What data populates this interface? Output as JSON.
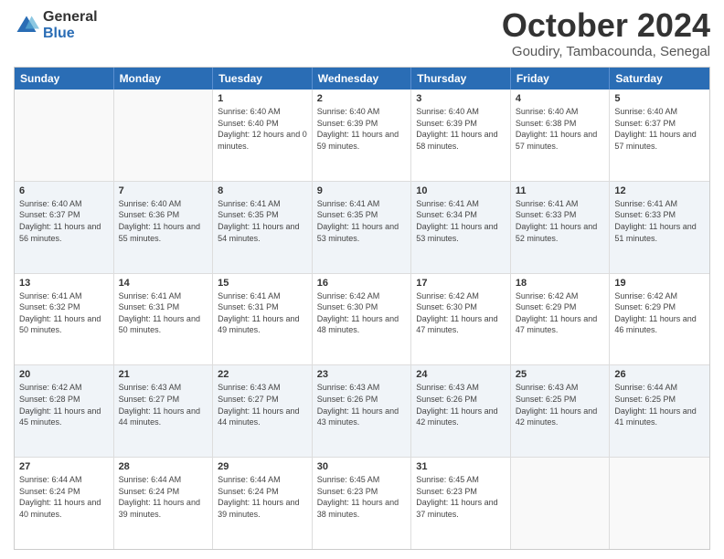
{
  "logo": {
    "general": "General",
    "blue": "Blue"
  },
  "title": "October 2024",
  "location": "Goudiry, Tambacounda, Senegal",
  "dayHeaders": [
    "Sunday",
    "Monday",
    "Tuesday",
    "Wednesday",
    "Thursday",
    "Friday",
    "Saturday"
  ],
  "weeks": [
    [
      {
        "day": "",
        "info": "",
        "empty": true
      },
      {
        "day": "",
        "info": "",
        "empty": true
      },
      {
        "day": "1",
        "info": "Sunrise: 6:40 AM\nSunset: 6:40 PM\nDaylight: 12 hours and 0 minutes.",
        "empty": false
      },
      {
        "day": "2",
        "info": "Sunrise: 6:40 AM\nSunset: 6:39 PM\nDaylight: 11 hours and 59 minutes.",
        "empty": false
      },
      {
        "day": "3",
        "info": "Sunrise: 6:40 AM\nSunset: 6:39 PM\nDaylight: 11 hours and 58 minutes.",
        "empty": false
      },
      {
        "day": "4",
        "info": "Sunrise: 6:40 AM\nSunset: 6:38 PM\nDaylight: 11 hours and 57 minutes.",
        "empty": false
      },
      {
        "day": "5",
        "info": "Sunrise: 6:40 AM\nSunset: 6:37 PM\nDaylight: 11 hours and 57 minutes.",
        "empty": false
      }
    ],
    [
      {
        "day": "6",
        "info": "Sunrise: 6:40 AM\nSunset: 6:37 PM\nDaylight: 11 hours and 56 minutes.",
        "empty": false
      },
      {
        "day": "7",
        "info": "Sunrise: 6:40 AM\nSunset: 6:36 PM\nDaylight: 11 hours and 55 minutes.",
        "empty": false
      },
      {
        "day": "8",
        "info": "Sunrise: 6:41 AM\nSunset: 6:35 PM\nDaylight: 11 hours and 54 minutes.",
        "empty": false
      },
      {
        "day": "9",
        "info": "Sunrise: 6:41 AM\nSunset: 6:35 PM\nDaylight: 11 hours and 53 minutes.",
        "empty": false
      },
      {
        "day": "10",
        "info": "Sunrise: 6:41 AM\nSunset: 6:34 PM\nDaylight: 11 hours and 53 minutes.",
        "empty": false
      },
      {
        "day": "11",
        "info": "Sunrise: 6:41 AM\nSunset: 6:33 PM\nDaylight: 11 hours and 52 minutes.",
        "empty": false
      },
      {
        "day": "12",
        "info": "Sunrise: 6:41 AM\nSunset: 6:33 PM\nDaylight: 11 hours and 51 minutes.",
        "empty": false
      }
    ],
    [
      {
        "day": "13",
        "info": "Sunrise: 6:41 AM\nSunset: 6:32 PM\nDaylight: 11 hours and 50 minutes.",
        "empty": false
      },
      {
        "day": "14",
        "info": "Sunrise: 6:41 AM\nSunset: 6:31 PM\nDaylight: 11 hours and 50 minutes.",
        "empty": false
      },
      {
        "day": "15",
        "info": "Sunrise: 6:41 AM\nSunset: 6:31 PM\nDaylight: 11 hours and 49 minutes.",
        "empty": false
      },
      {
        "day": "16",
        "info": "Sunrise: 6:42 AM\nSunset: 6:30 PM\nDaylight: 11 hours and 48 minutes.",
        "empty": false
      },
      {
        "day": "17",
        "info": "Sunrise: 6:42 AM\nSunset: 6:30 PM\nDaylight: 11 hours and 47 minutes.",
        "empty": false
      },
      {
        "day": "18",
        "info": "Sunrise: 6:42 AM\nSunset: 6:29 PM\nDaylight: 11 hours and 47 minutes.",
        "empty": false
      },
      {
        "day": "19",
        "info": "Sunrise: 6:42 AM\nSunset: 6:29 PM\nDaylight: 11 hours and 46 minutes.",
        "empty": false
      }
    ],
    [
      {
        "day": "20",
        "info": "Sunrise: 6:42 AM\nSunset: 6:28 PM\nDaylight: 11 hours and 45 minutes.",
        "empty": false
      },
      {
        "day": "21",
        "info": "Sunrise: 6:43 AM\nSunset: 6:27 PM\nDaylight: 11 hours and 44 minutes.",
        "empty": false
      },
      {
        "day": "22",
        "info": "Sunrise: 6:43 AM\nSunset: 6:27 PM\nDaylight: 11 hours and 44 minutes.",
        "empty": false
      },
      {
        "day": "23",
        "info": "Sunrise: 6:43 AM\nSunset: 6:26 PM\nDaylight: 11 hours and 43 minutes.",
        "empty": false
      },
      {
        "day": "24",
        "info": "Sunrise: 6:43 AM\nSunset: 6:26 PM\nDaylight: 11 hours and 42 minutes.",
        "empty": false
      },
      {
        "day": "25",
        "info": "Sunrise: 6:43 AM\nSunset: 6:25 PM\nDaylight: 11 hours and 42 minutes.",
        "empty": false
      },
      {
        "day": "26",
        "info": "Sunrise: 6:44 AM\nSunset: 6:25 PM\nDaylight: 11 hours and 41 minutes.",
        "empty": false
      }
    ],
    [
      {
        "day": "27",
        "info": "Sunrise: 6:44 AM\nSunset: 6:24 PM\nDaylight: 11 hours and 40 minutes.",
        "empty": false
      },
      {
        "day": "28",
        "info": "Sunrise: 6:44 AM\nSunset: 6:24 PM\nDaylight: 11 hours and 39 minutes.",
        "empty": false
      },
      {
        "day": "29",
        "info": "Sunrise: 6:44 AM\nSunset: 6:24 PM\nDaylight: 11 hours and 39 minutes.",
        "empty": false
      },
      {
        "day": "30",
        "info": "Sunrise: 6:45 AM\nSunset: 6:23 PM\nDaylight: 11 hours and 38 minutes.",
        "empty": false
      },
      {
        "day": "31",
        "info": "Sunrise: 6:45 AM\nSunset: 6:23 PM\nDaylight: 11 hours and 37 minutes.",
        "empty": false
      },
      {
        "day": "",
        "info": "",
        "empty": true
      },
      {
        "day": "",
        "info": "",
        "empty": true
      }
    ]
  ]
}
